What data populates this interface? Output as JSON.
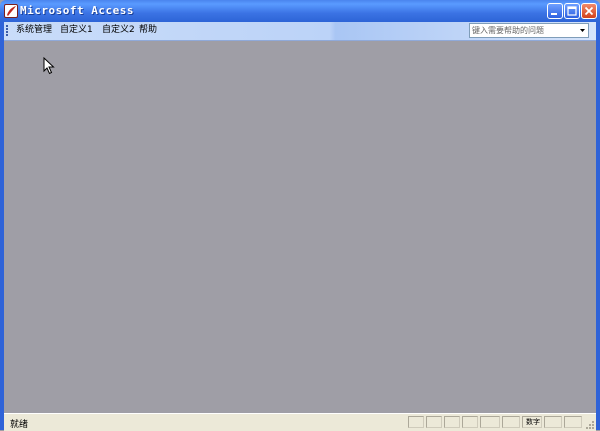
{
  "window": {
    "title": "Microsoft Access"
  },
  "menu": {
    "items": [
      "系统管理",
      "自定义1",
      "自定义2",
      "帮助"
    ]
  },
  "help_search": {
    "placeholder": "键入需要帮助的问题"
  },
  "status": {
    "text": "就绪",
    "mode_indicator": "数字"
  },
  "colors": {
    "titlebar": "#2d64d6",
    "client_bg": "#9f9ea6",
    "menubar": "#c9dcf9",
    "statusbar": "#ece9d8"
  }
}
